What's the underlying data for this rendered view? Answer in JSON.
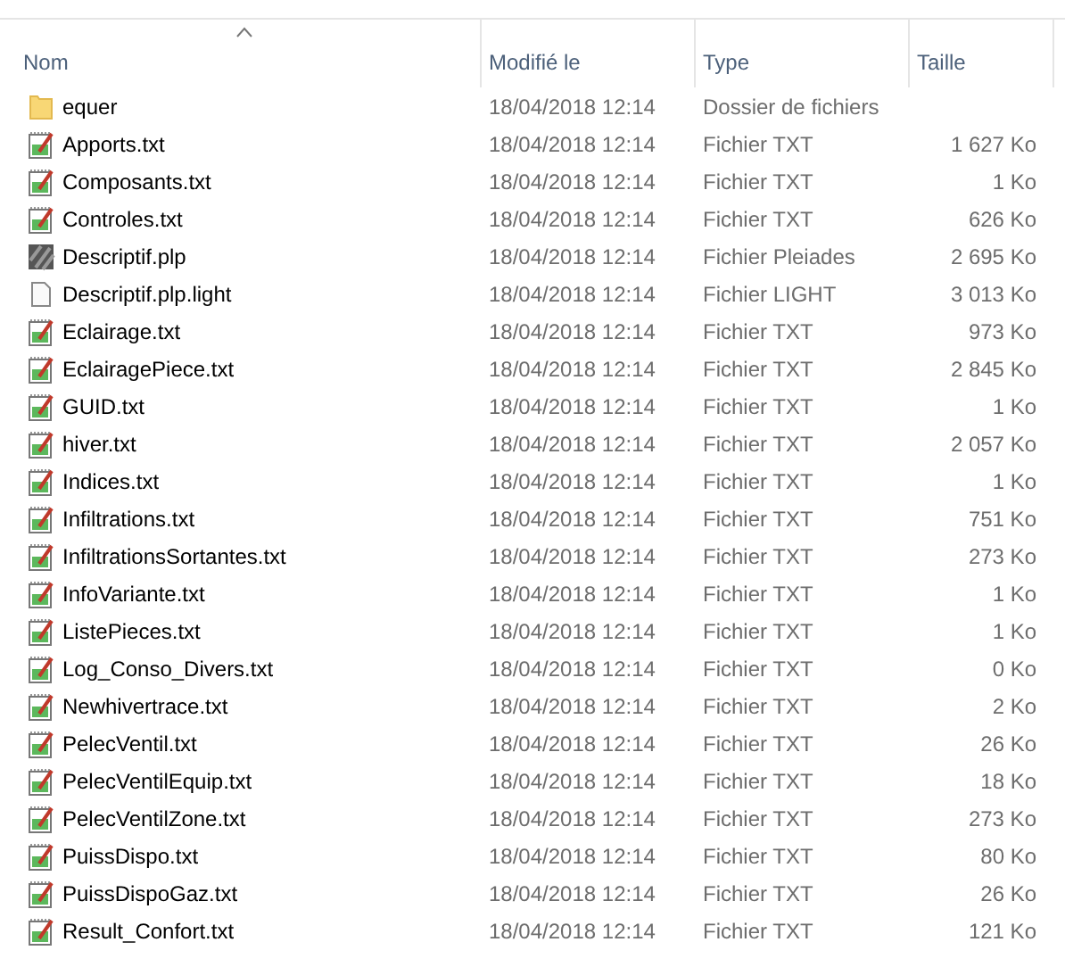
{
  "columns": [
    "Nom",
    "Modifié le",
    "Type",
    "Taille"
  ],
  "rows": [
    {
      "kind": "folder",
      "name": "equer",
      "modified": "18/04/2018 12:14",
      "type": "Dossier de fichiers",
      "size": ""
    },
    {
      "kind": "txt",
      "name": "Apports.txt",
      "modified": "18/04/2018 12:14",
      "type": "Fichier TXT",
      "size": "1 627 Ko"
    },
    {
      "kind": "txt",
      "name": "Composants.txt",
      "modified": "18/04/2018 12:14",
      "type": "Fichier TXT",
      "size": "1 Ko"
    },
    {
      "kind": "txt",
      "name": "Controles.txt",
      "modified": "18/04/2018 12:14",
      "type": "Fichier TXT",
      "size": "626 Ko"
    },
    {
      "kind": "plp",
      "name": "Descriptif.plp",
      "modified": "18/04/2018 12:14",
      "type": "Fichier Pleiades",
      "size": "2 695 Ko"
    },
    {
      "kind": "blank",
      "name": "Descriptif.plp.light",
      "modified": "18/04/2018 12:14",
      "type": "Fichier LIGHT",
      "size": "3 013 Ko"
    },
    {
      "kind": "txt",
      "name": "Eclairage.txt",
      "modified": "18/04/2018 12:14",
      "type": "Fichier TXT",
      "size": "973 Ko"
    },
    {
      "kind": "txt",
      "name": "EclairagePiece.txt",
      "modified": "18/04/2018 12:14",
      "type": "Fichier TXT",
      "size": "2 845 Ko"
    },
    {
      "kind": "txt",
      "name": "GUID.txt",
      "modified": "18/04/2018 12:14",
      "type": "Fichier TXT",
      "size": "1 Ko"
    },
    {
      "kind": "txt",
      "name": "hiver.txt",
      "modified": "18/04/2018 12:14",
      "type": "Fichier TXT",
      "size": "2 057 Ko"
    },
    {
      "kind": "txt",
      "name": "Indices.txt",
      "modified": "18/04/2018 12:14",
      "type": "Fichier TXT",
      "size": "1 Ko"
    },
    {
      "kind": "txt",
      "name": "Infiltrations.txt",
      "modified": "18/04/2018 12:14",
      "type": "Fichier TXT",
      "size": "751 Ko"
    },
    {
      "kind": "txt",
      "name": "InfiltrationsSortantes.txt",
      "modified": "18/04/2018 12:14",
      "type": "Fichier TXT",
      "size": "273 Ko"
    },
    {
      "kind": "txt",
      "name": "InfoVariante.txt",
      "modified": "18/04/2018 12:14",
      "type": "Fichier TXT",
      "size": "1 Ko"
    },
    {
      "kind": "txt",
      "name": "ListePieces.txt",
      "modified": "18/04/2018 12:14",
      "type": "Fichier TXT",
      "size": "1 Ko"
    },
    {
      "kind": "txt",
      "name": "Log_Conso_Divers.txt",
      "modified": "18/04/2018 12:14",
      "type": "Fichier TXT",
      "size": "0 Ko"
    },
    {
      "kind": "txt",
      "name": "Newhivertrace.txt",
      "modified": "18/04/2018 12:14",
      "type": "Fichier TXT",
      "size": "2 Ko"
    },
    {
      "kind": "txt",
      "name": "PelecVentil.txt",
      "modified": "18/04/2018 12:14",
      "type": "Fichier TXT",
      "size": "26 Ko"
    },
    {
      "kind": "txt",
      "name": "PelecVentilEquip.txt",
      "modified": "18/04/2018 12:14",
      "type": "Fichier TXT",
      "size": "18 Ko"
    },
    {
      "kind": "txt",
      "name": "PelecVentilZone.txt",
      "modified": "18/04/2018 12:14",
      "type": "Fichier TXT",
      "size": "273 Ko"
    },
    {
      "kind": "txt",
      "name": "PuissDispo.txt",
      "modified": "18/04/2018 12:14",
      "type": "Fichier TXT",
      "size": "80 Ko"
    },
    {
      "kind": "txt",
      "name": "PuissDispoGaz.txt",
      "modified": "18/04/2018 12:14",
      "type": "Fichier TXT",
      "size": "26 Ko"
    },
    {
      "kind": "txt",
      "name": "Result_Confort.txt",
      "modified": "18/04/2018 12:14",
      "type": "Fichier TXT",
      "size": "121 Ko"
    }
  ]
}
